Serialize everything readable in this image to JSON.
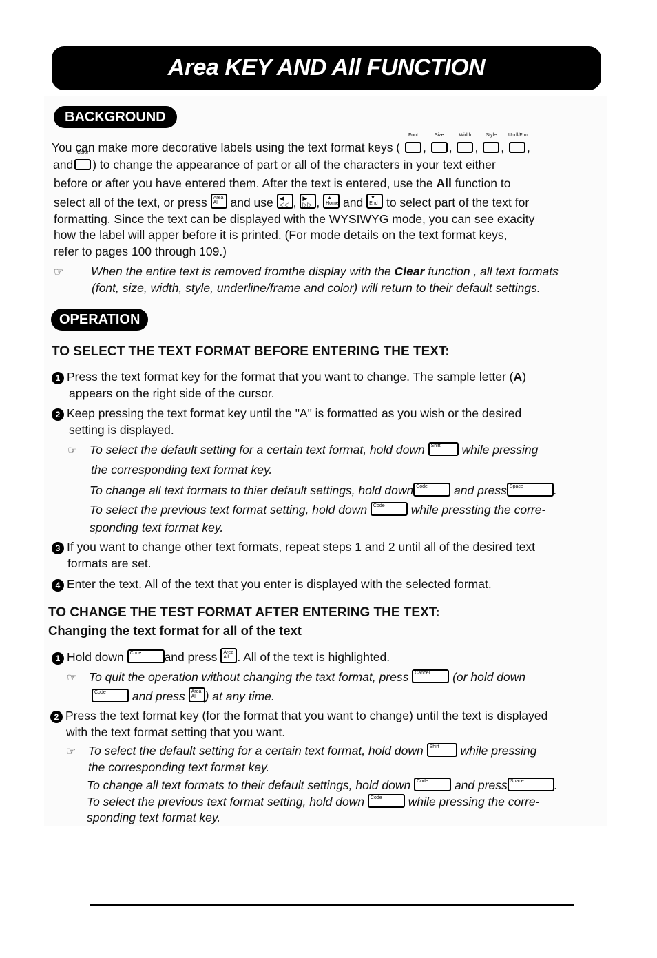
{
  "page": {
    "title": "Area KEY AND All FUNCTION"
  },
  "background": {
    "heading": "BACKGROUND",
    "p1a": "You can make more decorative labels using the text format keys (",
    "format_keys": [
      "Font",
      "Size",
      "Width",
      "Style",
      "Undl/Frm"
    ],
    "p1b": "and",
    "color_key": "Color",
    "p1c": ") to change the appearance of part or all of the characters in your text either",
    "p2a": "before or after you have entered them.  After the text is entered, use the ",
    "p2_bold": "All",
    "p2b": " function to",
    "p3a": "select all of the text, or press",
    "p3b": "and use",
    "p3c": "and",
    "p3d": "to select part of the text for",
    "nav_keys": {
      "area_all": "Area All",
      "left": "◀ ◁◁",
      "right": "▶ ▷▷",
      "home": "▲ Home",
      "end": "▼ End"
    },
    "p4": "formatting.  Since the text can be displayed with the WYSIWYG mode, you can see exacity",
    "p5": "how the label will apper before it is printed.  (For mode details on the text format keys,",
    "p6": "refer to pages 100 through 109.)",
    "note_a": "When the entire text is removed fromthe display with the ",
    "note_bold": "Clear",
    "note_b": " function , all text formats",
    "note_c": "(font, size, width, style, underline/frame and color) will return to their default settings."
  },
  "operation": {
    "heading": "OPERATION",
    "section1": {
      "heading": "TO SELECT THE TEXT FORMAT BEFORE ENTERING THE TEXT:",
      "step1_num": "1",
      "step1a": "Press the text format key for the format that you want to change.  The sample letter (",
      "step1_sample": "A",
      "step1b": ")",
      "step1c": "appears on the right side of the cursor.",
      "step2_num": "2",
      "step2a": "Keep pressing the text format key until the \"A\" is formatted as you wish or the desired",
      "step2b": "setting is displayed.",
      "note1a": "To select the default setting for a certain text format, hold down",
      "note1b": "while pressing",
      "note1c": "the corresponding text format key.",
      "note2a": "To change all text formats to thier default settings, hold down",
      "note2b": "and press",
      "note2c": ".",
      "note3a": "To select the previous text format setting, hold down",
      "note3b": "while pressting the corre-",
      "note3c": "sponding text format key.",
      "step3_num": "3",
      "step3a": "If you want to change other text formats, repeat steps 1 and 2 until all of the desired text",
      "step3b": "formats are set.",
      "step4_num": "4",
      "step4": "Enter the text.  All of the text that you enter is displayed with the selected format."
    },
    "section2": {
      "heading": "TO CHANGE THE TEST FORMAT AFTER ENTERING THE TEXT:",
      "subheading": "Changing the  text format for all of the text",
      "step1_num": "1",
      "step1a": "Hold down",
      "step1b": "and press",
      "step1c": ". All of the text is highlighted.",
      "note1a": "To quit the operation without changing the taxt format, press",
      "note1b": "(or hold down",
      "note1c": "and press",
      "note1d": ") at any time.",
      "step2_num": "2",
      "step2a": "Press the text format key (for the format that you want to change) until the text is displayed",
      "step2b": "with the text format setting that you want.",
      "note2a": "To select the default setting for a certain text format, hold down",
      "note2b": "while pressing",
      "note2c": "the corresponding text format key.",
      "note3a": "To change all text formats to their default settings, hold down",
      "note3b": "and press",
      "note3c": ".",
      "note4a": "To select the previous text format setting, hold down",
      "note4b": "while pressing the corre-",
      "note4c": "sponding text format key."
    }
  },
  "keys": {
    "shift": "Shift",
    "code": "Code",
    "space": "Space",
    "cancel": "Cancel",
    "area": "Area",
    "all": "All"
  },
  "icons": {
    "note": "☞"
  }
}
